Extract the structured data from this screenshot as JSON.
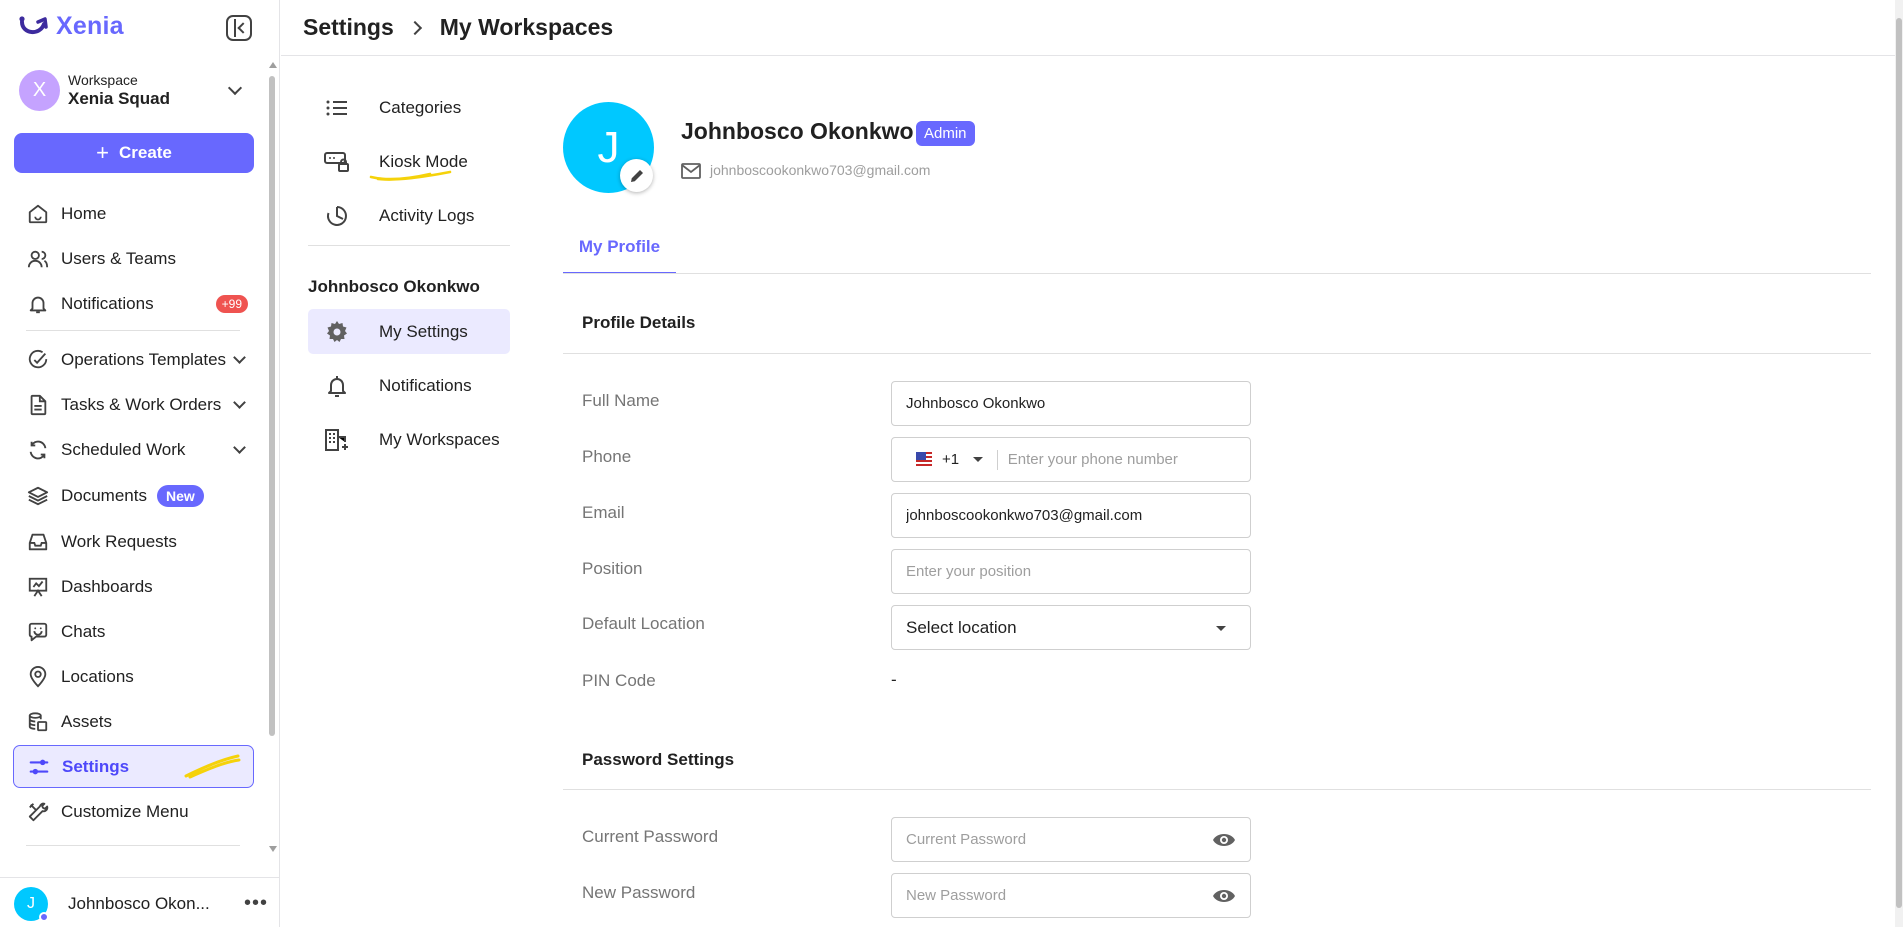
{
  "app": {
    "name": "Xenia"
  },
  "workspace": {
    "label": "Workspace",
    "name": "Xenia Squad",
    "initial": "X"
  },
  "sidebar": {
    "create_label": "Create",
    "items": [
      {
        "label": "Home"
      },
      {
        "label": "Users & Teams"
      },
      {
        "label": "Notifications",
        "badge": "+99"
      },
      {
        "label": "Operations Templates"
      },
      {
        "label": "Tasks & Work Orders"
      },
      {
        "label": "Scheduled Work"
      },
      {
        "label": "Documents",
        "badge": "New"
      },
      {
        "label": "Work Requests"
      },
      {
        "label": "Dashboards"
      },
      {
        "label": "Chats"
      },
      {
        "label": "Locations"
      },
      {
        "label": "Assets"
      },
      {
        "label": "Settings"
      },
      {
        "label": "Customize Menu"
      }
    ],
    "user": {
      "name": "Johnbosco Okon...",
      "initial": "J"
    }
  },
  "header": {
    "breadcrumb_root": "Settings",
    "breadcrumb_current": "My Workspaces"
  },
  "submenu": {
    "items": [
      {
        "label": "Categories"
      },
      {
        "label": "Kiosk Mode"
      },
      {
        "label": "Activity Logs"
      }
    ],
    "user_heading": "Johnbosco Okonkwo",
    "user_items": [
      {
        "label": "My Settings"
      },
      {
        "label": "Notifications"
      },
      {
        "label": "My Workspaces"
      }
    ]
  },
  "profile": {
    "initial": "J",
    "name": "Johnbosco Okonkwo",
    "role": "Admin",
    "email": "johnboscookonkwo703@gmail.com",
    "tab": "My Profile",
    "details_title": "Profile Details",
    "fields": {
      "full_name_label": "Full Name",
      "full_name_value": "Johnbosco Okonkwo",
      "phone_label": "Phone",
      "phone_code": "+1",
      "phone_placeholder": "Enter your phone number",
      "email_label": "Email",
      "email_value": "johnboscookonkwo703@gmail.com",
      "position_label": "Position",
      "position_placeholder": "Enter your position",
      "location_label": "Default Location",
      "location_value": "Select location",
      "pin_label": "PIN Code",
      "pin_value": "-"
    },
    "password_title": "Password Settings",
    "password": {
      "current_label": "Current Password",
      "current_placeholder": "Current Password",
      "new_label": "New Password",
      "new_placeholder": "New Password"
    }
  },
  "colors": {
    "accent": "#6868fe",
    "active_bg": "#ebeaff",
    "avatar": "#00c8ff",
    "badge_red": "#ef5350",
    "highlight": "#f5d20a"
  }
}
